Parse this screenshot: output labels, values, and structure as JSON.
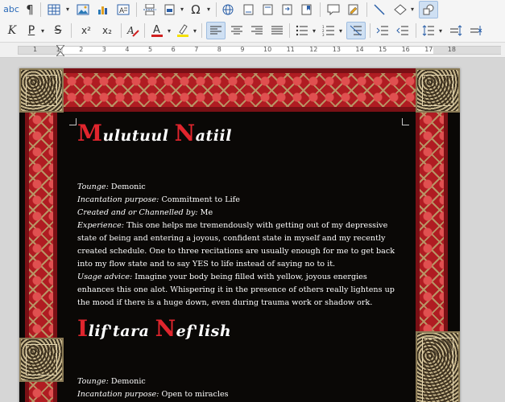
{
  "toolbar_row1": {
    "spelling_label": "abc",
    "pilcrow_label": "¶",
    "omega_label": "Ω"
  },
  "toolbar_row2": {
    "italic_label": "K",
    "underline_label": "P",
    "strike_label": "S",
    "superscript_label": "x²",
    "subscript_label": "x₂",
    "font_color": "#d02020",
    "highlight_color": "#f5e000"
  },
  "ruler": {
    "numbers": [
      "1",
      "1",
      "2",
      "3",
      "4",
      "5",
      "6",
      "7",
      "8",
      "9",
      "10",
      "11",
      "12",
      "13",
      "14",
      "15",
      "16",
      "17",
      "18"
    ]
  },
  "document": {
    "section1": {
      "title_cap1": "M",
      "title_rest1": "ulutuul ",
      "title_cap2": "N",
      "title_rest2": "atiil",
      "tongue_label": "Tounge:",
      "tongue_value": " Demonic",
      "purpose_label": "Incantation purpose:",
      "purpose_value": " Commitment to Life",
      "created_label": "Created and or Channelled by:",
      "created_value": " Me",
      "experience_label": "Experience:",
      "experience_value": " This one helps me tremendously with getting out of my depressive state of being and entering a joyous, confident state in myself and my recently created schedule. One to three recitations are usually enough for me to get back into my flow state and to say YES to life instead of saying no to it.",
      "advice_label": "Usage advice:",
      "advice_value": " Imagine your body being filled with yellow, joyous energies enhances this one alot. Whispering it in the presence of others really lightens up the mood if there is a huge down, even during trauma work or shadow ork."
    },
    "section2": {
      "title_cap1": "I",
      "title_rest1": "lif'tara ",
      "title_cap2": "N",
      "title_rest2": "ef'lish",
      "tongue_label": "Tounge:",
      "tongue_value": " Demonic",
      "purpose_label": "Incantation purpose:",
      "purpose_value": " Open to miracles"
    }
  }
}
